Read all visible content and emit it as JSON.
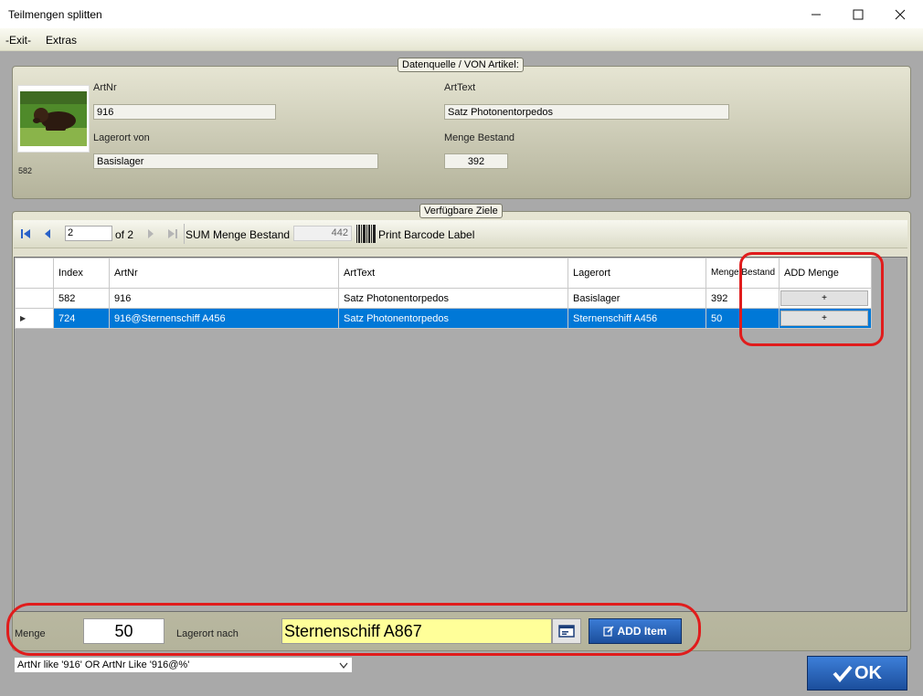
{
  "window": {
    "title": "Teilmengen splitten",
    "minimize": "—",
    "maximize": "☐",
    "close": "✕"
  },
  "menu": {
    "items": [
      "-Exit-",
      "Extras"
    ]
  },
  "source_group": {
    "legend": "Datenquelle / VON Artikel:",
    "image_caption": "582",
    "artnr_label": "ArtNr",
    "artnr_value": "916",
    "arttext_label": "ArtText",
    "arttext_value": "Satz Photonentorpedos",
    "lagerort_label": "Lagerort von",
    "lagerort_value": "Basislager",
    "menge_label": "Menge Bestand",
    "menge_value": "392"
  },
  "target_group": {
    "legend": "Verfügbare Ziele"
  },
  "toolbar": {
    "position": "2",
    "of_label": "of 2",
    "sum_label": "SUM Menge Bestand",
    "sum_value": "442",
    "print_label": "Print Barcode Label"
  },
  "grid": {
    "columns": [
      "Index",
      "ArtNr",
      "ArtText",
      "Lagerort",
      "Menge Bestand",
      "ADD Menge"
    ],
    "rows": [
      {
        "index": "582",
        "artnr": "916",
        "arttext": "Satz Photonentorpedos",
        "lagerort": "Basislager",
        "menge": "392",
        "add": "+"
      },
      {
        "index": "724",
        "artnr": "916@Sternenschiff A456",
        "arttext": "Satz Photonentorpedos",
        "lagerort": "Sternenschiff A456",
        "menge": "50",
        "add": "+"
      }
    ],
    "selected_row_marker": "▶"
  },
  "bottom": {
    "menge_label": "Menge",
    "menge_value": "50",
    "lagerort_label": "Lagerort nach",
    "lagerort_value": "Sternenschiff A867",
    "add_item_label": "ADD Item",
    "filter_value": "ArtNr like '916' OR ArtNr Like '916@%'",
    "ok_label": "OK"
  },
  "colors": {
    "selection": "#0078d7",
    "highlight_field": "#ffff99",
    "annotation": "#e01c1c",
    "ok_button": "#1e5ca8"
  }
}
